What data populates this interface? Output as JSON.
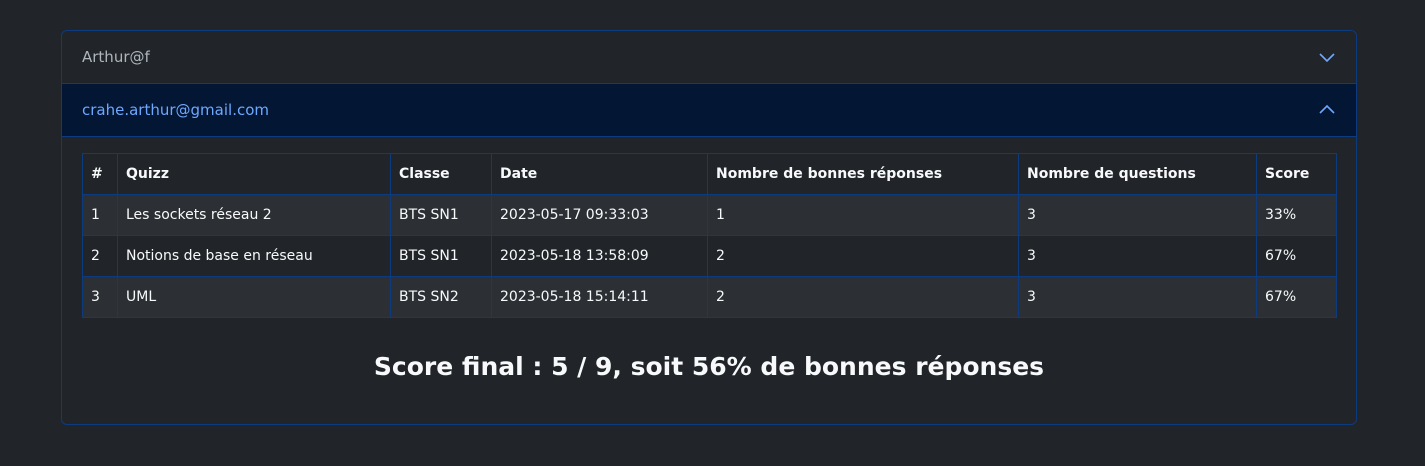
{
  "accordion": {
    "items": [
      {
        "label": "Arthur@f",
        "state": "collapsed"
      },
      {
        "label": "crahe.arthur@gmail.com",
        "state": "expanded"
      }
    ]
  },
  "table": {
    "headers": [
      "#",
      "Quizz",
      "Classe",
      "Date",
      "Nombre de bonnes réponses",
      "Nombre de questions",
      "Score"
    ],
    "rows": [
      [
        "1",
        "Les sockets réseau 2",
        "BTS SN1",
        "2023-05-17 09:33:03",
        "1",
        "3",
        "33%"
      ],
      [
        "2",
        "Notions de base en réseau",
        "BTS SN1",
        "2023-05-18 13:58:09",
        "2",
        "3",
        "67%"
      ],
      [
        "3",
        "UML",
        "BTS SN2",
        "2023-05-18 15:14:11",
        "2",
        "3",
        "67%"
      ]
    ]
  },
  "summary": {
    "text": "Score final : 5 / 9, soit 56% de bonnes réponses"
  },
  "colors": {
    "background": "#212529",
    "border": "#0d3b80",
    "active_header_bg": "#031633",
    "active_header_text": "#6ea8fe",
    "chevron": "#6ea8fe"
  },
  "icons": {
    "collapsed": "chevron-down-icon",
    "expanded": "chevron-up-icon"
  }
}
